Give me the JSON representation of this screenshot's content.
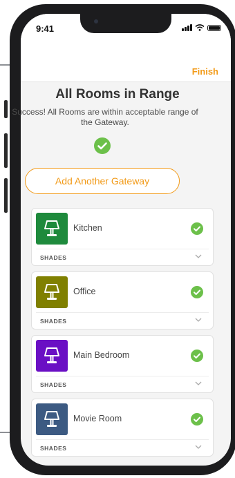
{
  "status": {
    "time": "9:41"
  },
  "nav": {
    "finish_label": "Finish"
  },
  "header": {
    "title": "All Rooms in Range",
    "subtitle": "Success! All Rooms are within acceptable range of the Gateway."
  },
  "actions": {
    "add_gateway_label": "Add Another Gateway"
  },
  "colors": {
    "accent": "#f29a17",
    "success": "#6cc04a"
  },
  "rooms": [
    {
      "name": "Kitchen",
      "section": "SHADES",
      "color": "#1e8a3c",
      "icon": "lamp-icon",
      "in_range": true
    },
    {
      "name": "Office",
      "section": "SHADES",
      "color": "#808000",
      "icon": "lamp-icon",
      "in_range": true
    },
    {
      "name": "Main Bedroom",
      "section": "SHADES",
      "color": "#6a0fc4",
      "icon": "lamp-icon",
      "in_range": true
    },
    {
      "name": "Movie Room",
      "section": "SHADES",
      "color": "#3c5a82",
      "icon": "lamp-icon",
      "in_range": true
    }
  ]
}
